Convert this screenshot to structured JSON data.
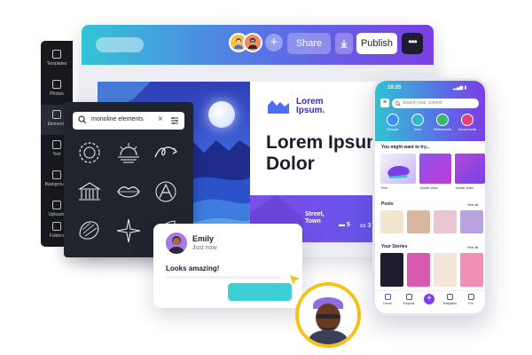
{
  "editor": {
    "toolbar": {
      "share_label": "Share",
      "publish_label": "Publish",
      "more_label": "•••",
      "download_icon": "download-icon",
      "add_collaborator_label": "+"
    },
    "nav_items": [
      {
        "label": "Templates",
        "icon": "templates-icon"
      },
      {
        "label": "Photos",
        "icon": "photos-icon"
      },
      {
        "label": "Elements",
        "icon": "elements-icon"
      },
      {
        "label": "Text",
        "icon": "text-icon"
      },
      {
        "label": "Background",
        "icon": "background-icon"
      },
      {
        "label": "Uploads",
        "icon": "uploads-icon"
      },
      {
        "label": "Folders",
        "icon": "folders-icon"
      }
    ],
    "design": {
      "brand_name": "Lorem Ipsum.",
      "headline": "Lorem Ipsum Dolor",
      "band_text": "Street, Town",
      "stats": [
        "5",
        "3"
      ]
    }
  },
  "elements_panel": {
    "search_value": "monoline elements",
    "clear_label": "×"
  },
  "comment": {
    "name": "Emily",
    "time": "Just now",
    "text": "Looks amazing!"
  },
  "phone": {
    "status_time": "10:25",
    "search_placeholder": "Search your content",
    "categories": [
      {
        "label": "Designs",
        "color": "#3d8ef0"
      },
      {
        "label": "Docs",
        "color": "#2fb7c8"
      },
      {
        "label": "Whiteboards",
        "color": "#3bb56b"
      },
      {
        "label": "Social media",
        "color": "#e2417a"
      }
    ],
    "sections": {
      "try_title": "You might want to try...",
      "posts_title": "Posts",
      "stories_title": "Your Stories",
      "see_all": "See all"
    },
    "try_labels": [
      "Print",
      "Mobile Video",
      "Mobile Video"
    ],
    "tabs": [
      {
        "label": "Home"
      },
      {
        "label": "Projects"
      },
      {
        "label": "Templates"
      },
      {
        "label": "Pro"
      }
    ]
  },
  "colors": {
    "accent_cyan": "#33c4d6",
    "accent_purple": "#7a3fe4",
    "avatar_ring": "#f6c21a"
  }
}
